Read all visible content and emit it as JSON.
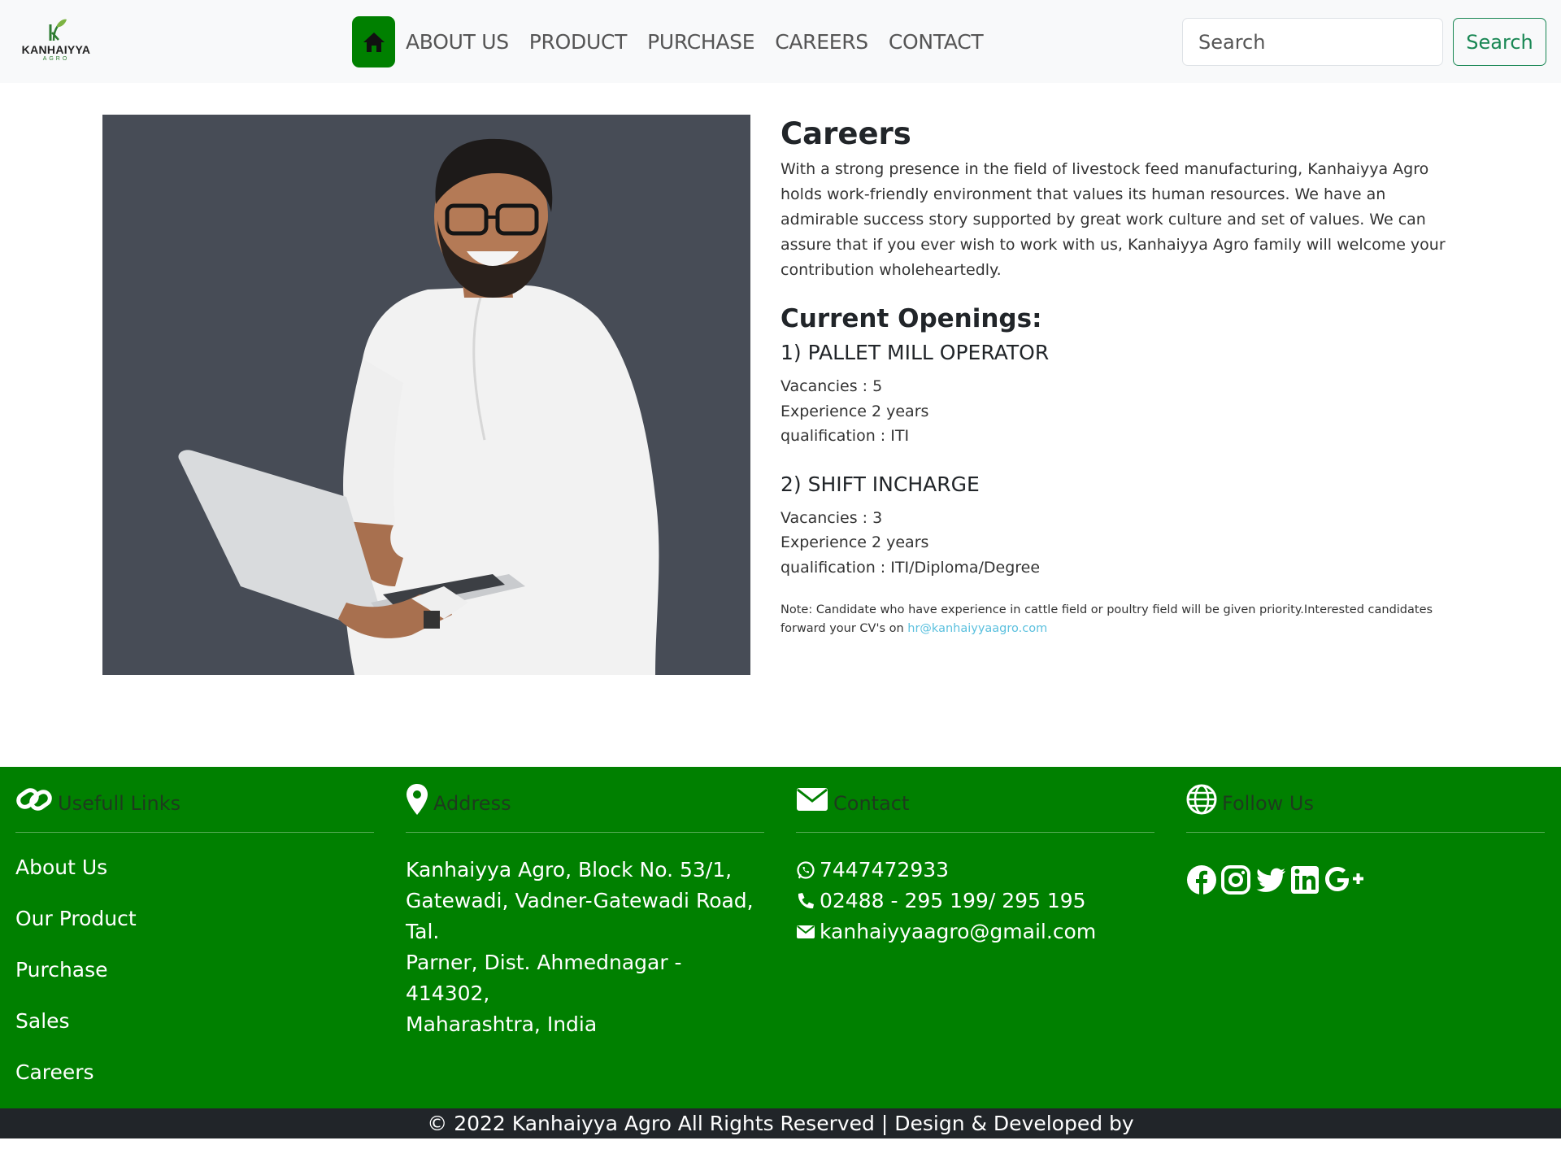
{
  "brand": {
    "name": "KANHAIYYA",
    "sub": "AGRO"
  },
  "nav": {
    "home_icon": "home-icon",
    "items": [
      "ABOUT US",
      "PRODUCT",
      "PURCHASE",
      "CAREERS",
      "CONTACT"
    ],
    "search_placeholder": "Search",
    "search_button": "Search"
  },
  "colors": {
    "brand_green": "#008000",
    "outline_green": "#198754",
    "dark_bar": "#212529",
    "link_blue": "#5bc0de"
  },
  "careers": {
    "title": "Careers",
    "intro": "With a strong presence in the field of livestock feed manufacturing, Kanhaiyya Agro holds work-friendly environment that values its human resources. We have an admirable success story supported by great work culture and set of values. We can assure that if you ever wish to work with us, Kanhaiyya Agro family will welcome your contribution wholeheartedly.",
    "openings_title": "Current Openings:",
    "jobs": [
      {
        "title": "1) PALLET MILL OPERATOR",
        "vacancies": "Vacancies : 5",
        "experience": "Experience 2 years",
        "qualification": "qualification : ITI"
      },
      {
        "title": "2) SHIFT INCHARGE",
        "vacancies": "Vacancies : 3",
        "experience": "Experience 2 years",
        "qualification": "qualification : ITI/Diploma/Degree"
      }
    ],
    "note_text": "Note: Candidate who have experience in cattle field or poultry field will be given priority.Interested candidates forward your CV's on ",
    "note_email": "hr@kanhaiyyaagro.com"
  },
  "footer": {
    "links": {
      "heading": "Usefull Links",
      "icon": "link-icon",
      "items": [
        "About Us",
        "Our Product",
        "Purchase",
        "Sales",
        "Careers"
      ]
    },
    "address": {
      "heading": "Address",
      "icon": "location-pin-icon",
      "lines": [
        "Kanhaiyya Agro, Block No. 53/1,",
        "Gatewadi, Vadner-Gatewadi Road, Tal.",
        "Parner, Dist. Ahmednagar - 414302,",
        "Maharashtra, India"
      ]
    },
    "contact": {
      "heading": "Contact",
      "icon": "envelope-icon",
      "whatsapp": "7447472933",
      "phone": "02488 - 295 199/ 295 195",
      "email": "kanhaiyyaagro@gmail.com"
    },
    "follow": {
      "heading": "Follow Us",
      "icon": "globe-icon",
      "socials": [
        "facebook-icon",
        "instagram-icon",
        "twitter-icon",
        "linkedin-icon",
        "google-plus-icon"
      ]
    }
  },
  "copyright": "© 2022 Kanhaiyya Agro All Rights Reserved | Design & Developed by"
}
